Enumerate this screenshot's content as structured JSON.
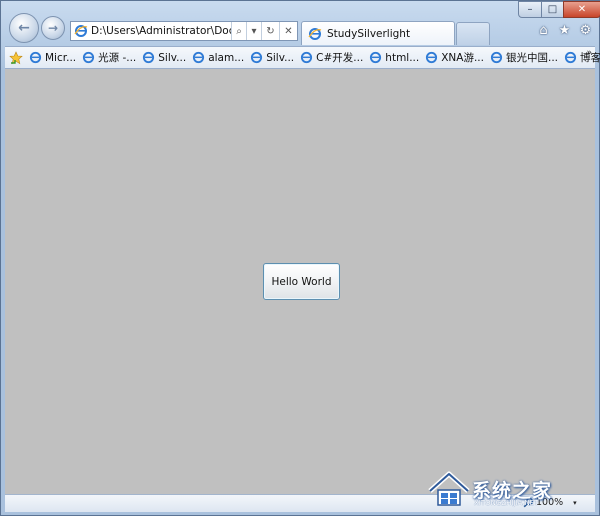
{
  "window": {
    "address_url": "D:\\Users\\Administrator\\Docume",
    "tab_title": "StudySilverlight",
    "caption_buttons": {
      "minimize": "–",
      "maximize": "□",
      "close": "✕"
    }
  },
  "toolbar": {
    "back_glyph": "←",
    "forward_glyph": "→",
    "search_glyph": "⌕",
    "dropdown_glyph": "▾",
    "refresh_glyph": "↻",
    "stop_glyph": "✕",
    "home_glyph": "⌂",
    "favorites_glyph": "★",
    "tools_glyph": "⚙"
  },
  "favorites": {
    "items": [
      {
        "label": "Micr..."
      },
      {
        "label": "光源 -..."
      },
      {
        "label": "Silv..."
      },
      {
        "label": "alam..."
      },
      {
        "label": "Silv..."
      },
      {
        "label": "C#开发..."
      },
      {
        "label": "html..."
      },
      {
        "label": "XNA游..."
      },
      {
        "label": "银光中国..."
      },
      {
        "label": "博客园 ..."
      }
    ],
    "overflow_glyph": "»"
  },
  "content": {
    "button_label": "Hello World",
    "background": "#c0c0c0"
  },
  "status_bar": {
    "zoom": "100%"
  },
  "watermark": {
    "text": "系统之家",
    "sub": "XITONGZHIJIA.NET"
  }
}
